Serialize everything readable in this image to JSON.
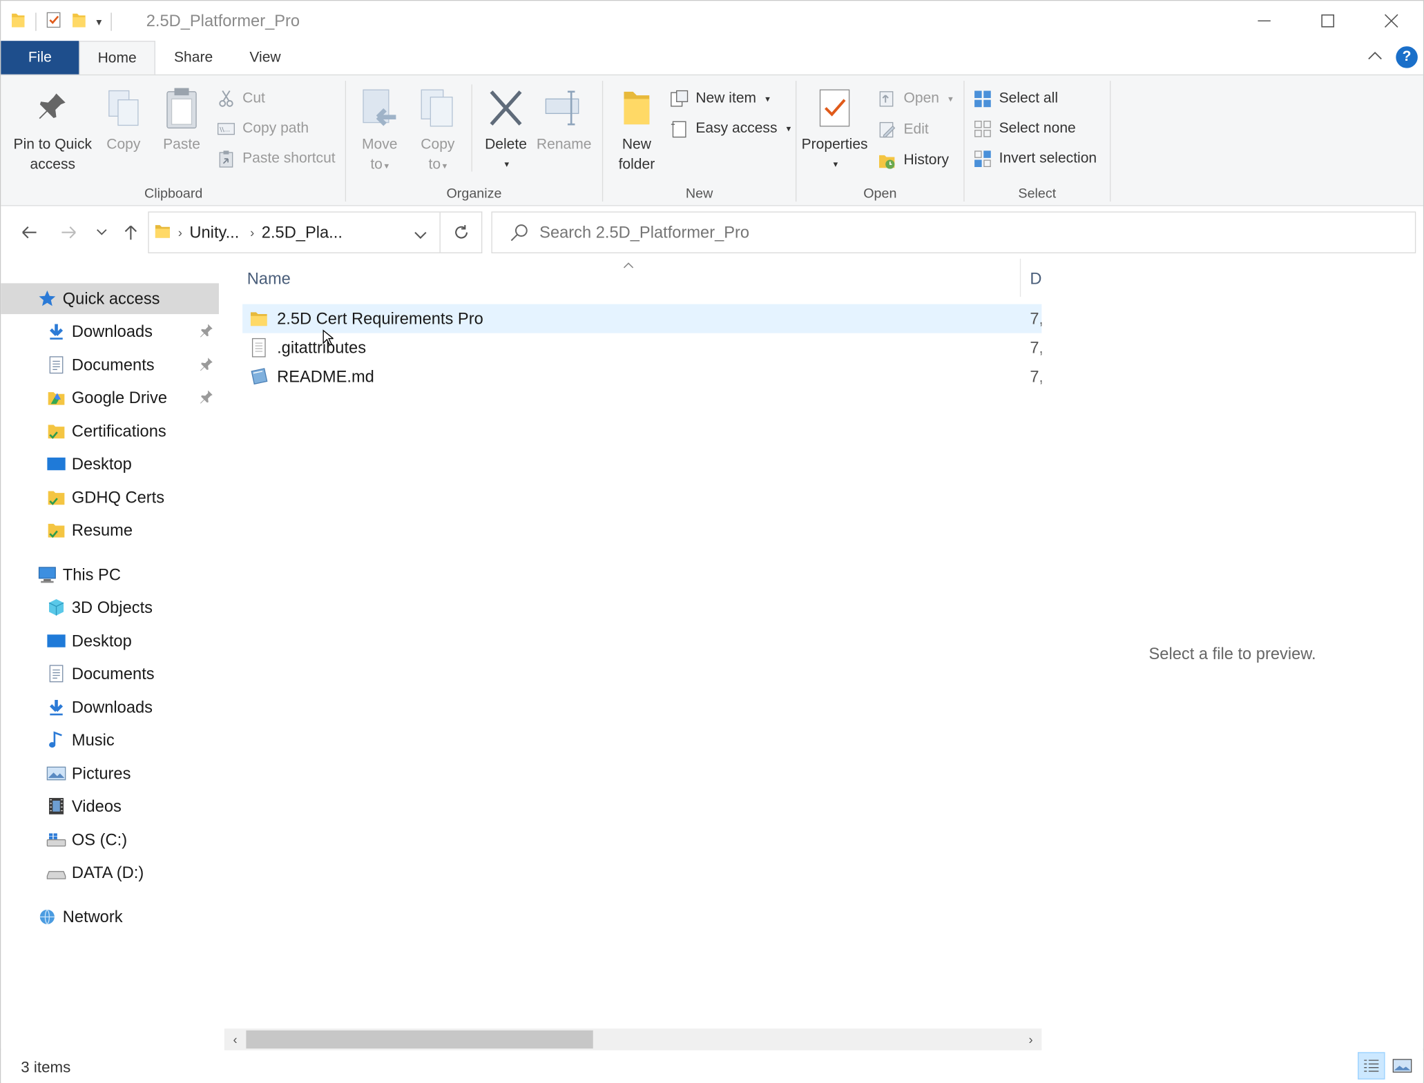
{
  "window": {
    "title": "2.5D_Platformer_Pro",
    "controls": {
      "minimize": "minimize-icon",
      "maximize": "maximize-icon",
      "close": "close-icon"
    }
  },
  "ribbon_tabs": {
    "file": "File",
    "home": "Home",
    "share": "Share",
    "view": "View"
  },
  "ribbon": {
    "clipboard": {
      "label": "Clipboard",
      "pin": "Pin to Quick access",
      "pin_line1": "Pin to Quick",
      "pin_line2": "access",
      "copy": "Copy",
      "paste": "Paste",
      "cut": "Cut",
      "copy_path": "Copy path",
      "paste_shortcut": "Paste shortcut"
    },
    "organize": {
      "label": "Organize",
      "move_line1": "Move",
      "move_line2": "to",
      "copy_line1": "Copy",
      "copy_line2": "to",
      "delete": "Delete",
      "rename": "Rename"
    },
    "new": {
      "label": "New",
      "new_folder_line1": "New",
      "new_folder_line2": "folder",
      "new_item": "New item",
      "easy_access": "Easy access"
    },
    "open": {
      "label": "Open",
      "properties": "Properties",
      "open": "Open",
      "edit": "Edit",
      "history": "History"
    },
    "select": {
      "label": "Select",
      "select_all": "Select all",
      "select_none": "Select none",
      "invert_selection": "Invert selection"
    }
  },
  "address": {
    "crumbs": [
      "Unity...",
      "2.5D_Pla..."
    ],
    "search_placeholder": "Search 2.5D_Platformer_Pro"
  },
  "navpane": {
    "quick_access": "Quick access",
    "quick_items": [
      {
        "label": "Downloads",
        "pinned": true
      },
      {
        "label": "Documents",
        "pinned": true
      },
      {
        "label": "Google Drive",
        "pinned": true
      },
      {
        "label": "Certifications",
        "pinned": false
      },
      {
        "label": "Desktop",
        "pinned": false
      },
      {
        "label": "GDHQ Certs",
        "pinned": false
      },
      {
        "label": "Resume",
        "pinned": false
      }
    ],
    "this_pc": "This PC",
    "pc_items": [
      "3D Objects",
      "Desktop",
      "Documents",
      "Downloads",
      "Music",
      "Pictures",
      "Videos",
      "OS (C:)",
      "DATA (D:)"
    ],
    "network": "Network"
  },
  "filelist": {
    "col_name": "Name",
    "col_date": "D",
    "rows": [
      {
        "name": "2.5D Cert Requirements Pro",
        "type": "folder",
        "date": "7,"
      },
      {
        "name": ".gitattributes",
        "type": "file",
        "date": "7,"
      },
      {
        "name": "README.md",
        "type": "md",
        "date": "7,"
      }
    ]
  },
  "preview": {
    "text": "Select a file to preview."
  },
  "status": {
    "items": "3 items"
  },
  "colors": {
    "file_tab": "#1e4e8c",
    "hover_row": "#e5f3ff",
    "selected_nav": "#d9d9d9",
    "help": "#1a6fc9"
  }
}
